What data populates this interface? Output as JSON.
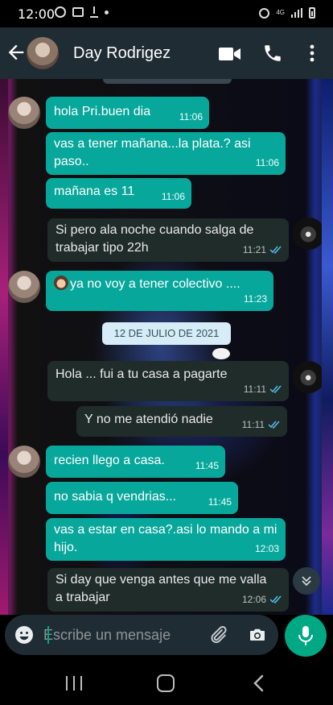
{
  "status_bar": {
    "time": "12:00"
  },
  "header": {
    "contact_name": "Day Rodrigez"
  },
  "date_divider": "12 DE JULIO DE 2021",
  "messages": [
    {
      "dir": "in",
      "text": "hola Pri.buen dia",
      "time": "11:06"
    },
    {
      "dir": "in",
      "text": "vas a tener mañana...la plata.? asi paso..",
      "time": "11:06"
    },
    {
      "dir": "in",
      "text": "mañana es 11",
      "time": "11:06"
    },
    {
      "dir": "out",
      "text": "Si pero ala noche cuando salga de trabajar tipo 22h",
      "time": "11:21",
      "status": "read"
    },
    {
      "dir": "in",
      "text": "ya no voy  a tener colectivo ....",
      "time": "11:23",
      "emoji": "woman-emoji"
    },
    {
      "dir": "out",
      "text": "Hola ... fui a tu casa a pagarte",
      "time": "11:11",
      "status": "read"
    },
    {
      "dir": "out",
      "text": "Y no me atendió nadie",
      "time": "11:11",
      "status": "read"
    },
    {
      "dir": "in",
      "text": "recien llego a casa.",
      "time": "11:45"
    },
    {
      "dir": "in",
      "text": "no sabia q vendrias...",
      "time": "11:45"
    },
    {
      "dir": "in",
      "text": "vas a estar en casa?.asi lo mando a mi hijo.",
      "time": "12:03"
    },
    {
      "dir": "out",
      "text": "Si day que venga antes que me valla a trabajar",
      "time": "12:06",
      "status": "read"
    }
  ],
  "input": {
    "placeholder": "Escribe un mensaje"
  },
  "colors": {
    "incoming_bubble": "#08a79b",
    "outgoing_bubble": "#1f2c2a",
    "accent": "#00a884",
    "header": "#1f2c33"
  }
}
